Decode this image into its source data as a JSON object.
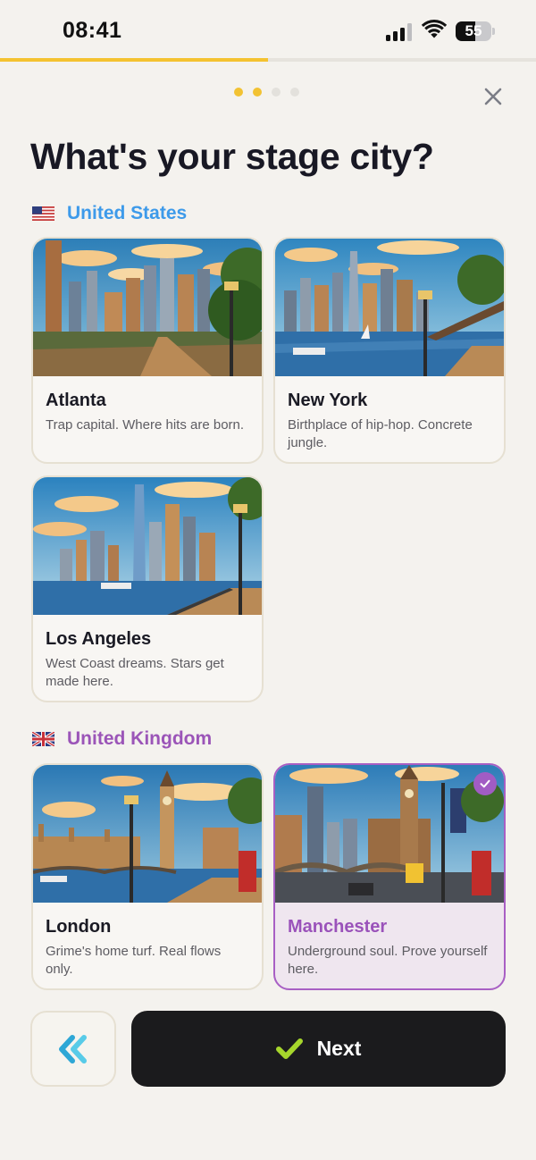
{
  "status_bar": {
    "time": "08:41",
    "battery_level": "55"
  },
  "progress": {
    "fraction": 0.5
  },
  "steps": {
    "total": 4,
    "completed": 2
  },
  "header": {
    "title": "What's your stage city?",
    "close_icon": "close-icon"
  },
  "sections": [
    {
      "country": "United States",
      "flag_icon": "us-flag-icon",
      "color": "#3d9aea",
      "cities": [
        {
          "name": "Atlanta",
          "description": "Trap capital. Where hits are born.",
          "selected": false
        },
        {
          "name": "New York",
          "description": "Birthplace of hip-hop. Concrete jungle.",
          "selected": false
        },
        {
          "name": "Los Angeles",
          "description": "West Coast dreams. Stars get made here.",
          "selected": false
        }
      ]
    },
    {
      "country": "United Kingdom",
      "flag_icon": "uk-flag-icon",
      "color": "#9b55b8",
      "cities": [
        {
          "name": "London",
          "description": "Grime's home turf. Real flows only.",
          "selected": false
        },
        {
          "name": "Manchester",
          "description": "Underground soul. Prove yourself here.",
          "selected": true
        }
      ]
    }
  ],
  "footer": {
    "back_icon": "double-chevron-left-icon",
    "next_icon": "checkmark-icon",
    "next_label": "Next"
  },
  "colors": {
    "accent_yellow": "#f4c230",
    "selected_purple": "#a15cc4",
    "back_chevron": "#4cc4e4",
    "next_check": "#a6d62c",
    "background": "#f4f2ee"
  }
}
